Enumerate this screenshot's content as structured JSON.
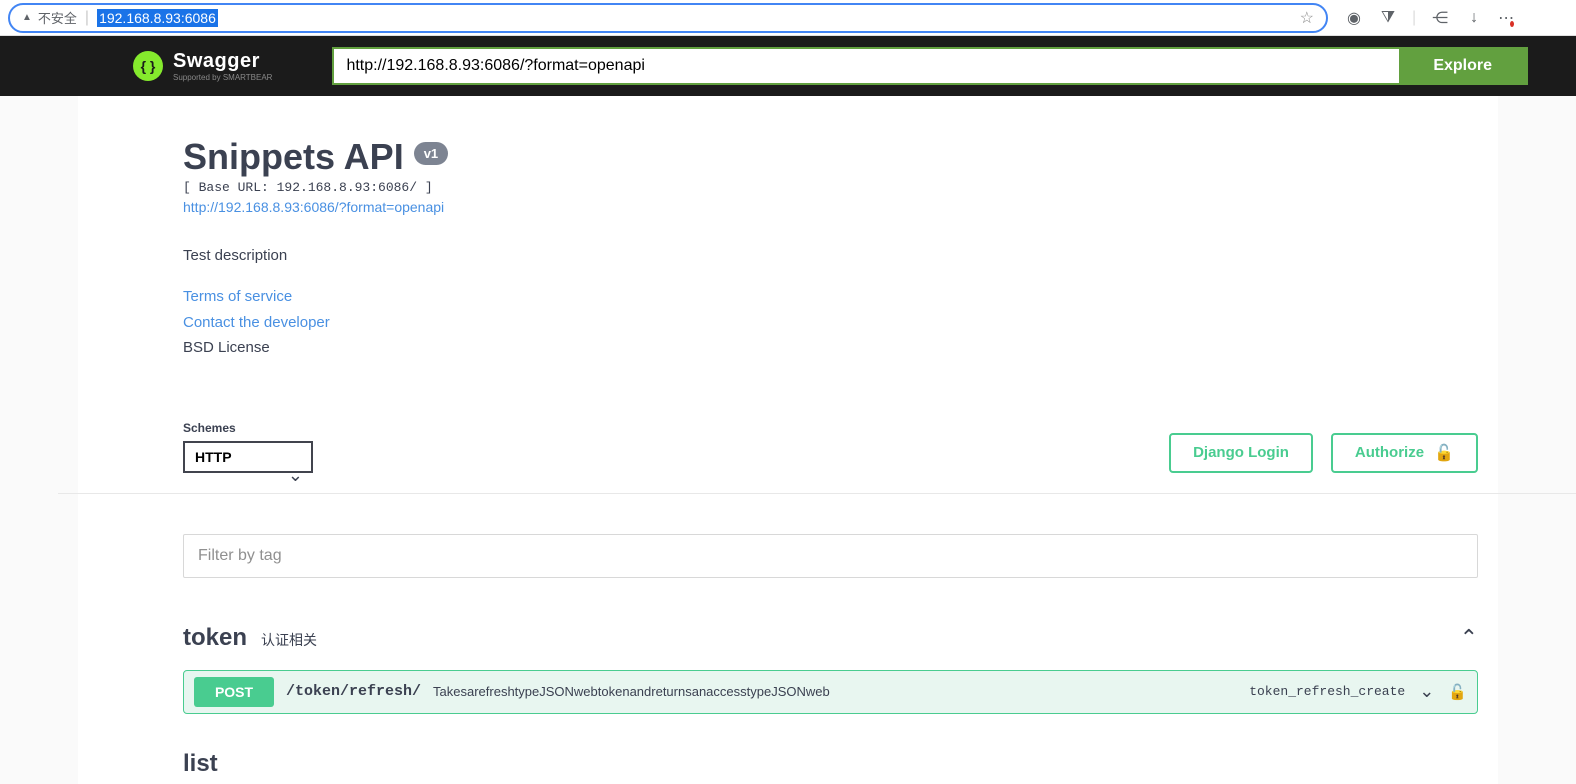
{
  "browser": {
    "not_secure_label": "不安全",
    "address": "192.168.8.93:6086"
  },
  "topbar": {
    "logo_main": "Swagger",
    "logo_sub": "Supported by SMARTBEAR",
    "spec_url": "http://192.168.8.93:6086/?format=openapi",
    "explore_label": "Explore"
  },
  "info": {
    "title": "Snippets API",
    "version": "v1",
    "base_url": "[ Base URL: 192.168.8.93:6086/ ]",
    "spec_link": "http://192.168.8.93:6086/?format=openapi",
    "description": "Test description",
    "terms_link": "Terms of service",
    "contact_link": "Contact the developer",
    "license": "BSD License"
  },
  "schemes": {
    "label": "Schemes",
    "selected": "HTTP"
  },
  "auth": {
    "django_login": "Django Login",
    "authorize": "Authorize"
  },
  "filter": {
    "placeholder": "Filter by tag"
  },
  "tags": {
    "token": {
      "name": "token",
      "desc": "认证相关",
      "ops": [
        {
          "method": "POST",
          "path": "/token/refresh/",
          "summary": "TakesarefreshtypeJSONwebtokenandreturnsanaccesstypeJSONweb",
          "op_id": "token_refresh_create"
        }
      ]
    },
    "list": {
      "name": "list"
    }
  }
}
